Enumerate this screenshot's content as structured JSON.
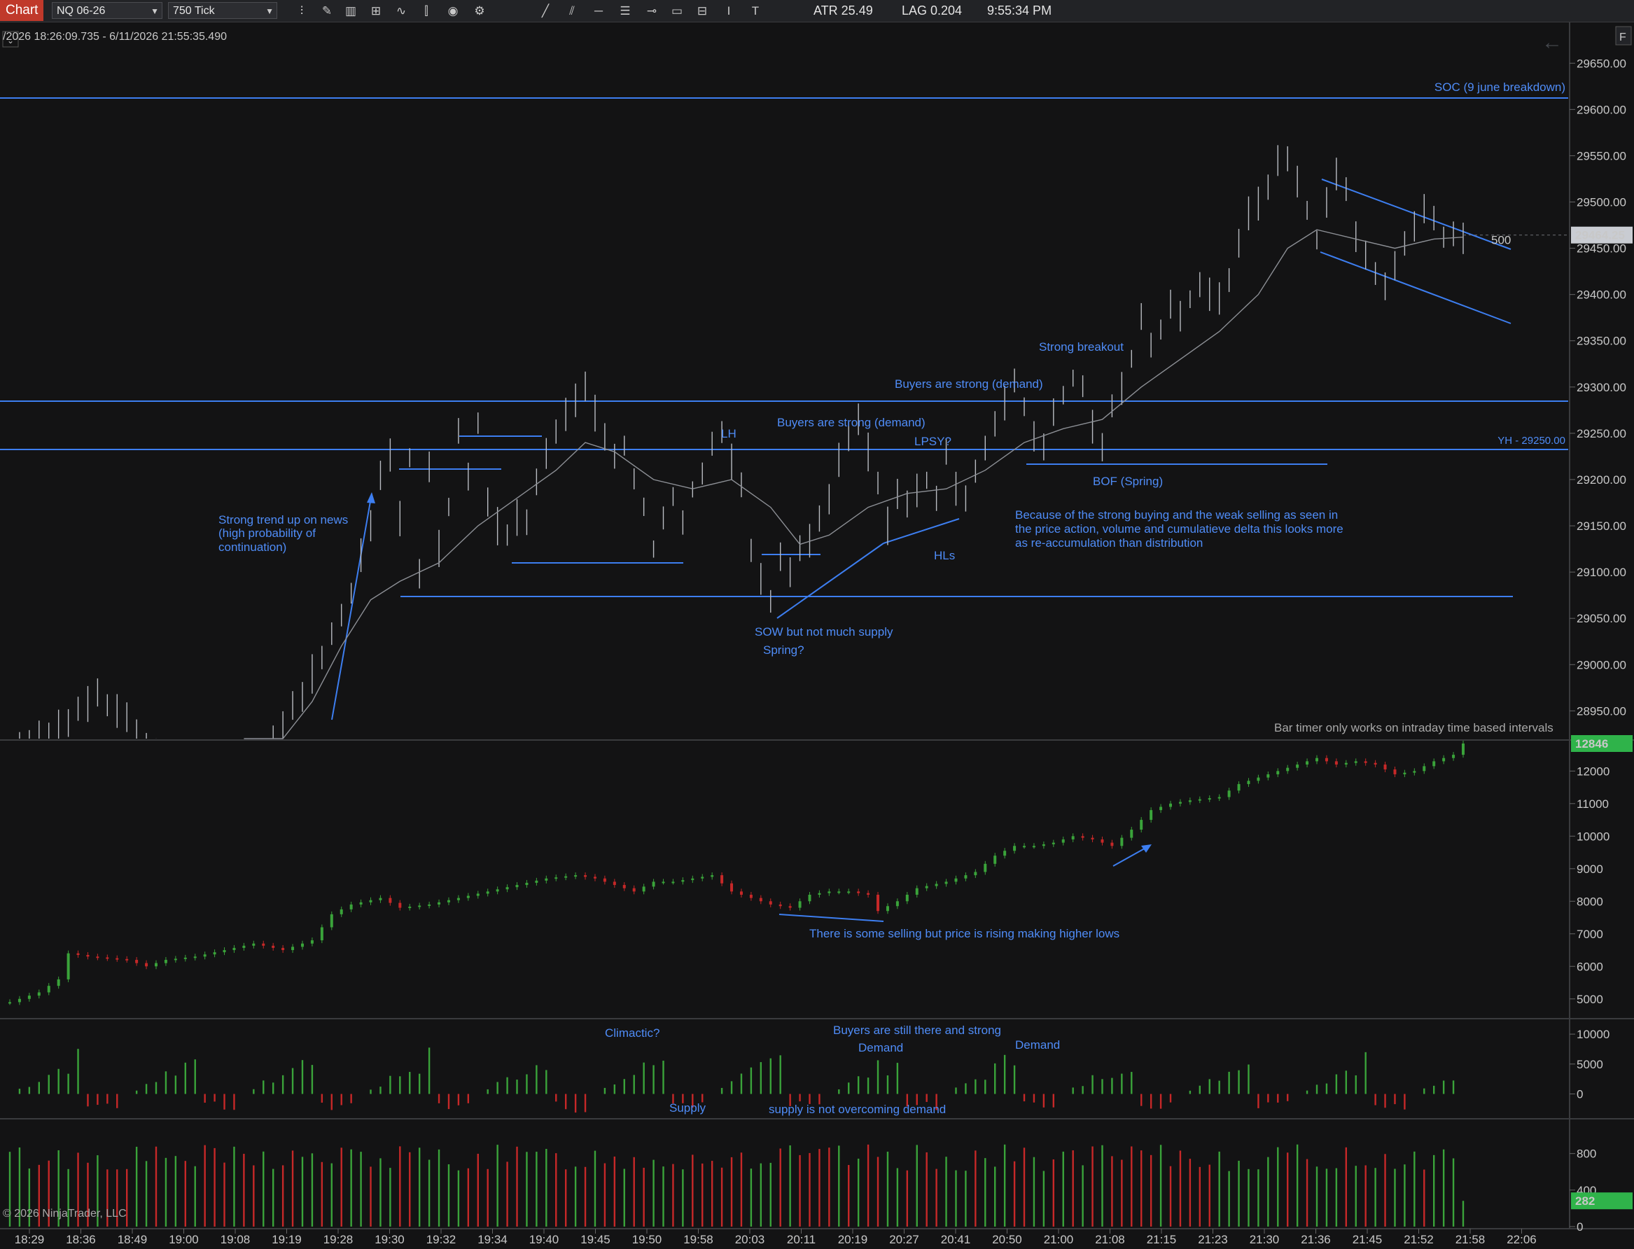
{
  "toolbar": {
    "chart_label": "Chart",
    "instrument": "NQ 06-26",
    "interval": "750 Tick",
    "atr": "ATR 25.49",
    "lag": "LAG 0.204",
    "clock": "9:55:34 PM"
  },
  "header": {
    "date_range": "/2026 18:26:09.735 - 6/11/2026 21:55:35.490",
    "corner_letter": "F",
    "bar_timer_note": "Bar timer only works on intraday time based intervals",
    "copyright": "© 2026 NinjaTrader, LLC"
  },
  "colors": {
    "background": "#131314",
    "annotation": "#4f8cf7",
    "level_line": "#3d7ef0",
    "price_line": "#b9bcc2",
    "up": "#3aa33a",
    "down": "#c62828",
    "last_price_bg": "#c9ccd2",
    "delta_badge_bg": "#2fb34a"
  },
  "chart_data": [
    {
      "type": "line",
      "panel": "price",
      "y_ticks": [
        28950,
        29000,
        29050,
        29100,
        29150,
        29200,
        29250,
        29300,
        29350,
        29400,
        29450,
        29500,
        29550,
        29600,
        29650
      ],
      "y_tick_labels": [
        "28950.00",
        "29000.00",
        "29050.00",
        "29100.00",
        "29150.00",
        "29200.00",
        "29250.00",
        "29300.00",
        "29350.00",
        "29400.00",
        "29450.00",
        "29500.00",
        "29550.00",
        "29600.00",
        "29650.00"
      ],
      "ylim": [
        28920,
        29685
      ],
      "last_price": "29464.25",
      "last_price_value": 29464.25,
      "ma_label": "500",
      "x_ticks": [
        "18:29",
        "18:36",
        "18:49",
        "19:00",
        "19:08",
        "19:19",
        "19:28",
        "19:30",
        "19:32",
        "19:34",
        "19:40",
        "19:45",
        "19:50",
        "19:58",
        "20:03",
        "20:11",
        "20:19",
        "20:27",
        "20:41",
        "20:50",
        "21:00",
        "21:08",
        "21:15",
        "21:23",
        "21:30",
        "21:36",
        "21:45",
        "21:52",
        "21:58",
        "22:06"
      ],
      "price_path": [
        [
          0,
          28900
        ],
        [
          5,
          28930
        ],
        [
          9,
          28965
        ],
        [
          12,
          28940
        ],
        [
          15,
          28905
        ],
        [
          24,
          28875
        ],
        [
          26,
          28900
        ],
        [
          29,
          28950
        ],
        [
          31,
          28990
        ],
        [
          33,
          29030
        ],
        [
          35,
          29080
        ],
        [
          37,
          29150
        ],
        [
          38,
          29200
        ],
        [
          39,
          29225
        ],
        [
          40,
          29160
        ],
        [
          41,
          29225
        ],
        [
          42,
          29100
        ],
        [
          43,
          29215
        ],
        [
          44,
          29125
        ],
        [
          45,
          29170
        ],
        [
          46,
          29250
        ],
        [
          47,
          29200
        ],
        [
          48,
          29260
        ],
        [
          49,
          29180
        ],
        [
          50,
          29150
        ],
        [
          51,
          29140
        ],
        [
          52,
          29160
        ],
        [
          53,
          29150
        ],
        [
          54,
          29200
        ],
        [
          55,
          29230
        ],
        [
          56,
          29250
        ],
        [
          57,
          29270
        ],
        [
          58,
          29285
        ],
        [
          59,
          29300
        ],
        [
          60,
          29270
        ],
        [
          61,
          29240
        ],
        [
          62,
          29225
        ],
        [
          63,
          29235
        ],
        [
          64,
          29200
        ],
        [
          65,
          29170
        ],
        [
          66,
          29125
        ],
        [
          67,
          29160
        ],
        [
          68,
          29180
        ],
        [
          69,
          29150
        ],
        [
          70,
          29190
        ],
        [
          71,
          29210
        ],
        [
          72,
          29240
        ],
        [
          73,
          29255
        ],
        [
          74,
          29220
        ],
        [
          75,
          29195
        ],
        [
          76,
          29120
        ],
        [
          77,
          29090
        ],
        [
          78,
          29070
        ],
        [
          79,
          29110
        ],
        [
          80,
          29100
        ],
        [
          81,
          29130
        ],
        [
          82,
          29135
        ],
        [
          83,
          29160
        ],
        [
          84,
          29180
        ],
        [
          85,
          29220
        ],
        [
          86,
          29250
        ],
        [
          87,
          29265
        ],
        [
          88,
          29230
        ],
        [
          89,
          29200
        ],
        [
          90,
          29150
        ],
        [
          91,
          29190
        ],
        [
          92,
          29170
        ],
        [
          93,
          29190
        ],
        [
          94,
          29200
        ],
        [
          95,
          29175
        ],
        [
          96,
          29235
        ],
        [
          97,
          29190
        ],
        [
          98,
          29180
        ],
        [
          99,
          29205
        ],
        [
          100,
          29230
        ],
        [
          101,
          29265
        ],
        [
          102,
          29285
        ],
        [
          103,
          29310
        ],
        [
          104,
          29280
        ],
        [
          105,
          29250
        ],
        [
          106,
          29235
        ],
        [
          107,
          29270
        ],
        [
          108,
          29290
        ],
        [
          109,
          29310
        ],
        [
          110,
          29300
        ],
        [
          111,
          29260
        ],
        [
          112,
          29240
        ],
        [
          113,
          29280
        ],
        [
          114,
          29300
        ],
        [
          115,
          29330
        ],
        [
          116,
          29370
        ],
        [
          117,
          29340
        ],
        [
          118,
          29360
        ],
        [
          119,
          29390
        ],
        [
          120,
          29380
        ],
        [
          121,
          29395
        ],
        [
          122,
          29410
        ],
        [
          123,
          29400
        ],
        [
          124,
          29395
        ],
        [
          125,
          29420
        ],
        [
          126,
          29460
        ],
        [
          127,
          29490
        ],
        [
          128,
          29500
        ],
        [
          129,
          29520
        ],
        [
          130,
          29540
        ],
        [
          131,
          29545
        ],
        [
          132,
          29520
        ],
        [
          133,
          29490
        ],
        [
          134,
          29460
        ],
        [
          135,
          29500
        ],
        [
          136,
          29530
        ],
        [
          137,
          29510
        ],
        [
          138,
          29460
        ],
        [
          139,
          29440
        ],
        [
          140,
          29420
        ],
        [
          141,
          29405
        ],
        [
          142,
          29430
        ],
        [
          143,
          29460
        ],
        [
          144,
          29470
        ],
        [
          145,
          29490
        ],
        [
          146,
          29480
        ],
        [
          147,
          29460
        ],
        [
          148,
          29465
        ],
        [
          149,
          29464
        ]
      ],
      "ma_path": [
        [
          24,
          28860
        ],
        [
          28,
          28900
        ],
        [
          31,
          28960
        ],
        [
          34,
          29020
        ],
        [
          37,
          29070
        ],
        [
          40,
          29090
        ],
        [
          44,
          29110
        ],
        [
          48,
          29150
        ],
        [
          52,
          29180
        ],
        [
          56,
          29210
        ],
        [
          59,
          29240
        ],
        [
          62,
          29230
        ],
        [
          66,
          29200
        ],
        [
          70,
          29190
        ],
        [
          74,
          29200
        ],
        [
          78,
          29170
        ],
        [
          81,
          29130
        ],
        [
          84,
          29140
        ],
        [
          88,
          29170
        ],
        [
          92,
          29185
        ],
        [
          96,
          29190
        ],
        [
          100,
          29210
        ],
        [
          104,
          29240
        ],
        [
          108,
          29255
        ],
        [
          112,
          29265
        ],
        [
          116,
          29300
        ],
        [
          120,
          29330
        ],
        [
          124,
          29360
        ],
        [
          128,
          29400
        ],
        [
          131,
          29450
        ],
        [
          134,
          29470
        ],
        [
          138,
          29460
        ],
        [
          142,
          29450
        ],
        [
          146,
          29460
        ],
        [
          149,
          29462
        ]
      ]
    },
    {
      "type": "bar",
      "panel": "cumulative-delta",
      "y_ticks": [
        5000,
        6000,
        7000,
        8000,
        9000,
        10000,
        11000,
        12000
      ],
      "y_tick_labels": [
        "5000",
        "6000",
        "7000",
        "8000",
        "9000",
        "10000",
        "11000",
        "12000"
      ],
      "ylim": [
        4500,
        12846
      ],
      "last_value": "12846",
      "last_value_num": 12846,
      "path": [
        [
          0,
          4900
        ],
        [
          3,
          5200
        ],
        [
          5,
          5600
        ],
        [
          6,
          6400
        ],
        [
          8,
          6300
        ],
        [
          12,
          6200
        ],
        [
          14,
          6000
        ],
        [
          16,
          6200
        ],
        [
          19,
          6300
        ],
        [
          22,
          6500
        ],
        [
          25,
          6700
        ],
        [
          28,
          6500
        ],
        [
          31,
          6800
        ],
        [
          33,
          7600
        ],
        [
          35,
          7900
        ],
        [
          38,
          8100
        ],
        [
          40,
          7800
        ],
        [
          43,
          7900
        ],
        [
          46,
          8100
        ],
        [
          49,
          8300
        ],
        [
          52,
          8500
        ],
        [
          55,
          8700
        ],
        [
          58,
          8800
        ],
        [
          60,
          8700
        ],
        [
          62,
          8500
        ],
        [
          64,
          8300
        ],
        [
          66,
          8600
        ],
        [
          68,
          8600
        ],
        [
          70,
          8700
        ],
        [
          72,
          8800
        ],
        [
          74,
          8300
        ],
        [
          76,
          8100
        ],
        [
          78,
          7900
        ],
        [
          80,
          7800
        ],
        [
          82,
          8200
        ],
        [
          84,
          8300
        ],
        [
          86,
          8300
        ],
        [
          88,
          8200
        ],
        [
          89,
          7700
        ],
        [
          91,
          8000
        ],
        [
          93,
          8400
        ],
        [
          96,
          8600
        ],
        [
          99,
          8900
        ],
        [
          101,
          9400
        ],
        [
          103,
          9700
        ],
        [
          105,
          9700
        ],
        [
          107,
          9800
        ],
        [
          109,
          10000
        ],
        [
          111,
          9900
        ],
        [
          113,
          9700
        ],
        [
          115,
          10200
        ],
        [
          117,
          10800
        ],
        [
          119,
          11000
        ],
        [
          121,
          11100
        ],
        [
          124,
          11200
        ],
        [
          126,
          11600
        ],
        [
          128,
          11800
        ],
        [
          130,
          12000
        ],
        [
          132,
          12200
        ],
        [
          134,
          12400
        ],
        [
          136,
          12200
        ],
        [
          138,
          12300
        ],
        [
          140,
          12200
        ],
        [
          142,
          11900
        ],
        [
          144,
          12000
        ],
        [
          146,
          12300
        ],
        [
          148,
          12500
        ],
        [
          149,
          12846
        ]
      ]
    },
    {
      "type": "bar",
      "panel": "delta-oscillator",
      "y_ticks": [
        0,
        5000,
        10000
      ],
      "y_tick_labels": [
        "0",
        "5000",
        "10000"
      ],
      "ylim": [
        -3800,
        12000
      ],
      "seed": 7
    },
    {
      "type": "bar",
      "panel": "volume",
      "y_ticks": [
        0,
        400,
        800
      ],
      "y_tick_labels": [
        "0",
        "400",
        "800"
      ],
      "ylim": [
        0,
        1150
      ],
      "last_value": "282",
      "last_value_num": 282,
      "seed": 13
    }
  ],
  "annotations": {
    "soc": "SOC (9 june breakdown)",
    "yh": "YH - 29250.00",
    "strong_trend_1": "Strong trend up on news",
    "strong_trend_2": "(high probability of",
    "strong_trend_3": "continuation)",
    "lh": "LH",
    "buyers_strong_1": "Buyers are strong (demand)",
    "buyers_strong_2": "Buyers are strong (demand)",
    "lpsy": "LPSY?",
    "strong_breakout": "Strong breakout",
    "bof_spring": "BOF (Spring)",
    "hls": "HLs",
    "sow": "SOW but not much supply",
    "spring": "Spring?",
    "because_1": "Because of the strong buying and the weak selling as seen in",
    "because_2": "the price action, volume and cumulatieve delta this looks more",
    "because_3": "as re-accumulation than distribution",
    "selling_note": "There is some selling but price is rising making higher lows",
    "climactic": "Climactic?",
    "supply": "Supply",
    "buyers_still": "Buyers are still there and strong",
    "demand_1": "Demand",
    "demand_2": "Demand",
    "supply_not": "supply is not overcoming demand"
  }
}
